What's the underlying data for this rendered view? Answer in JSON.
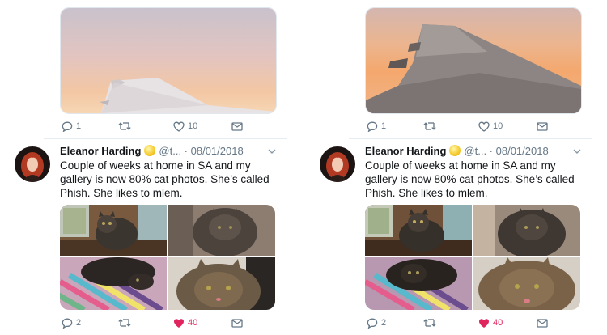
{
  "left": {
    "prev_actions": {
      "reply": "1",
      "retweet": "",
      "like": "10"
    },
    "tweet": {
      "name": "Eleanor Harding",
      "handle_date": "@t... · 08/01/2018",
      "text": "Couple of weeks at home in SA and my gallery is now 80% cat photos. She’s called Phish. She likes to mlem."
    },
    "actions": {
      "reply": "2",
      "retweet": "",
      "like": "40"
    }
  },
  "right": {
    "prev_actions": {
      "reply": "1",
      "retweet": "",
      "like": "10"
    },
    "tweet": {
      "name": "Eleanor Harding",
      "handle_date": "@t... · 08/01/2018",
      "text": "Couple of weeks at home in SA and my gallery is now 80% cat photos. She’s called Phish. She likes to mlem."
    },
    "actions": {
      "reply": "2",
      "retweet": "",
      "like": "40"
    }
  },
  "colors": {
    "like_active": "#e0245e",
    "meta": "#657786",
    "divider": "#e6ecf0"
  },
  "icons": [
    "reply-icon",
    "retweet-icon",
    "like-icon",
    "direct-message-icon",
    "chevron-down-icon",
    "sun-emoji-icon"
  ]
}
